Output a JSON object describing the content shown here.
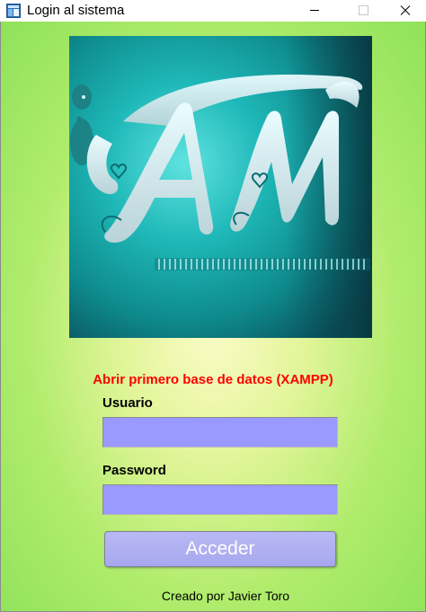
{
  "window": {
    "title": "Login al sistema",
    "icons": {
      "app": "app-window-icon",
      "minimize": "minimize-icon",
      "maximize": "maximize-icon",
      "close": "close-icon"
    }
  },
  "logo": {
    "letters": "AM",
    "description_icon": "am-logo-image"
  },
  "form": {
    "warning": "Abrir primero base de datos (XAMPP)",
    "usuario_label": "Usuario",
    "usuario_value": "",
    "password_label": "Password",
    "password_value": "",
    "submit_label": "Acceder"
  },
  "footer": {
    "credit": "Creado por Javier Toro"
  },
  "colors": {
    "warning": "#ff0000",
    "input_bg": "#9999ff",
    "button_bg": "#a7a7f0",
    "bg_center": "#fbfbc7",
    "bg_edge": "#8fe25a"
  }
}
